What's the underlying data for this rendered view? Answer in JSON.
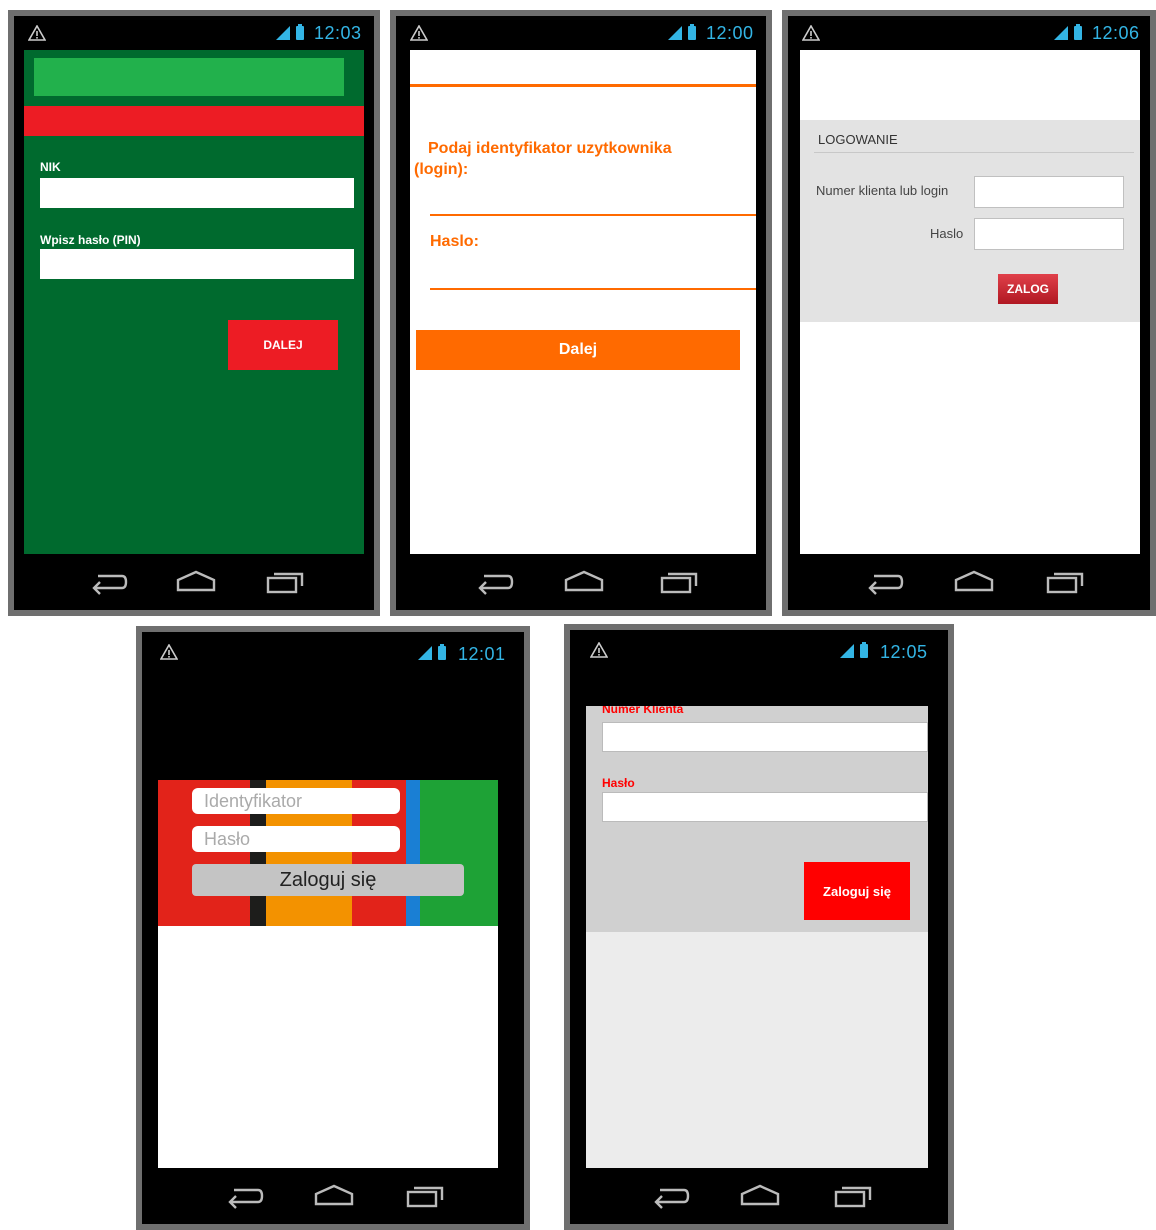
{
  "phones": [
    {
      "time": "12:03",
      "form": {
        "nik_label": "NIK",
        "pin_label": "Wpisz hasło (PIN)",
        "next_button": "DALEJ"
      },
      "colors": {
        "background": "#006a2e",
        "top_bar": "#22b14c",
        "accent": "#ed1c24"
      }
    },
    {
      "time": "12:00",
      "form": {
        "login_label": "Podaj identyfikator uzytkownika (login):",
        "password_label": "Haslo:",
        "next_button": "Dalej"
      },
      "colors": {
        "accent": "#ff6a00"
      }
    },
    {
      "time": "12:06",
      "form": {
        "title": "LOGOWANIE",
        "client_label": "Numer klienta lub login",
        "password_label": "Haslo",
        "login_button": "ZALOG"
      },
      "colors": {
        "panel": "#e3e3e3",
        "button": "#c8202a"
      }
    },
    {
      "time": "12:01",
      "form": {
        "id_placeholder": "Identyfikator",
        "password_placeholder": "Hasło",
        "login_button": "Zaloguj się"
      },
      "colors": {
        "stripes": [
          "#e2231a",
          "#1d1d1b",
          "#f39200",
          "#e2231a",
          "#1a7fd4",
          "#1ea236"
        ]
      }
    },
    {
      "time": "12:05",
      "form": {
        "client_label": "Numer Klienta",
        "password_label": "Hasło",
        "login_button": "Zaloguj się"
      },
      "colors": {
        "panel": "#d0d0d0",
        "label": "#ff0000",
        "button": "#ff0000"
      }
    }
  ]
}
